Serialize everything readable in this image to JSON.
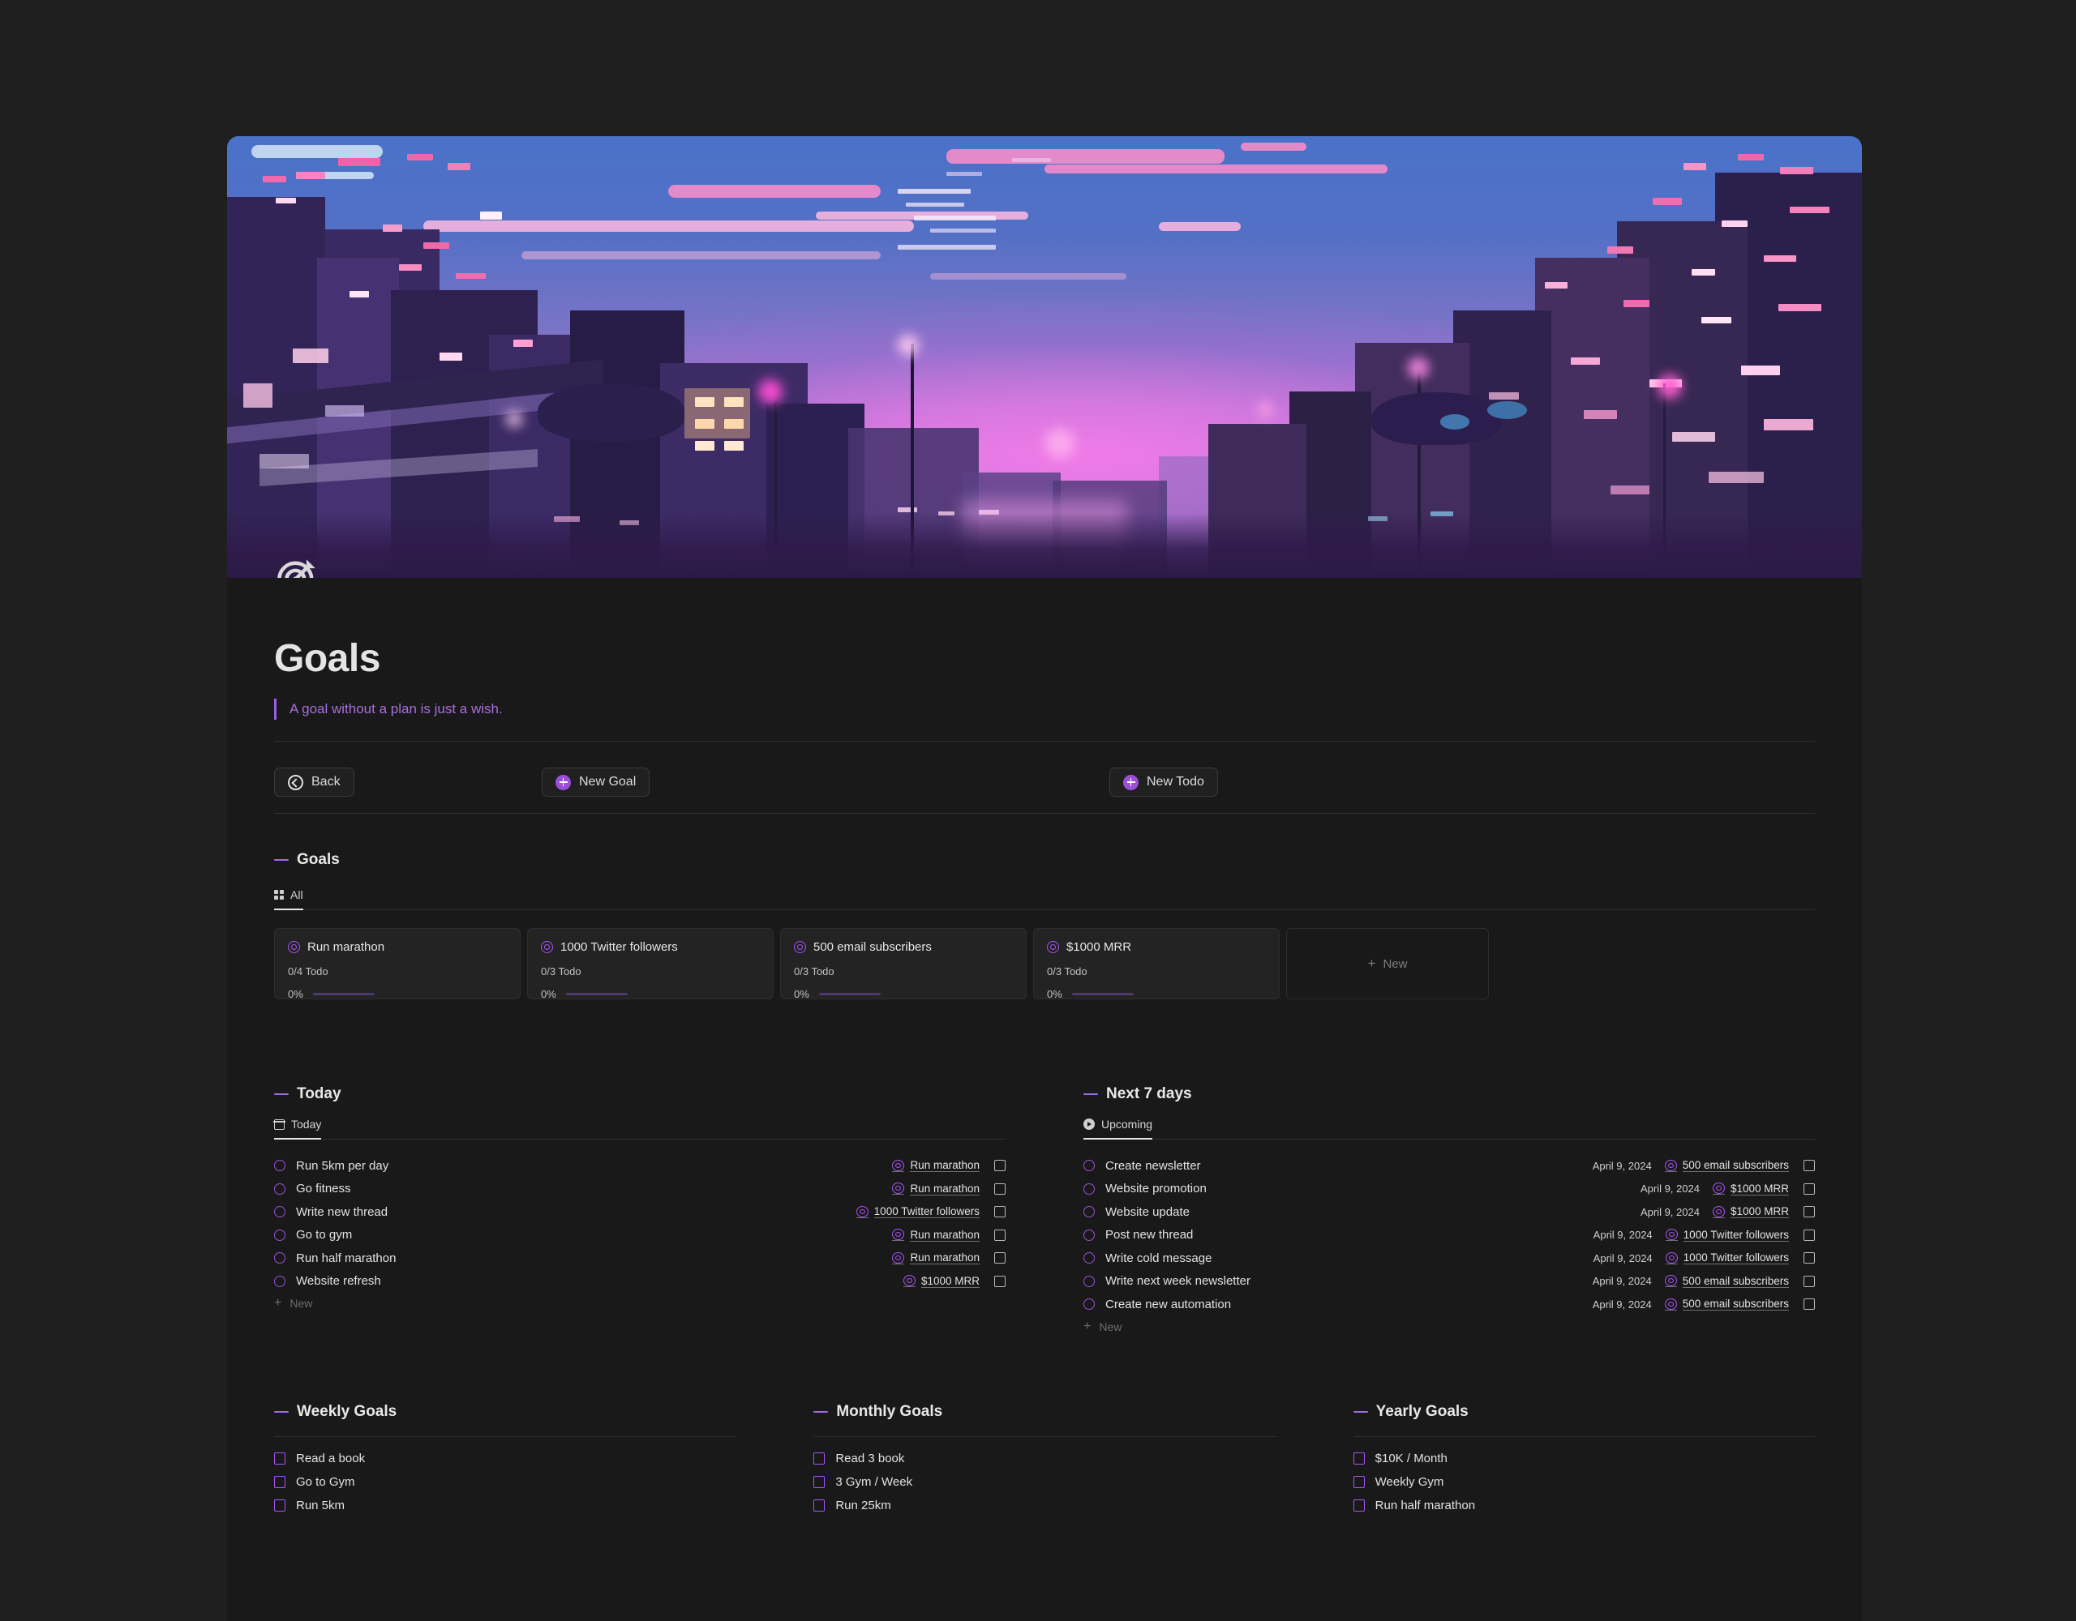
{
  "page": {
    "icon": "target-icon",
    "title": "Goals",
    "quote": "A goal without a plan is just a wish."
  },
  "toolbar": {
    "back_label": "Back",
    "new_goal_label": "New Goal",
    "new_todo_label": "New Todo"
  },
  "goals_section": {
    "heading": "Goals",
    "tab_label": "All",
    "new_card_label": "New",
    "cards": [
      {
        "title": "Run marathon",
        "todo": "0/4 Todo",
        "percent": "0%"
      },
      {
        "title": "1000 Twitter followers",
        "todo": "0/3 Todo",
        "percent": "0%"
      },
      {
        "title": "500 email subscribers",
        "todo": "0/3 Todo",
        "percent": "0%"
      },
      {
        "title": "$1000 MRR",
        "todo": "0/3 Todo",
        "percent": "0%"
      }
    ]
  },
  "today_section": {
    "heading": "Today",
    "tab_label": "Today",
    "new_label": "New",
    "tasks": [
      {
        "name": "Run 5km per day",
        "goal": "Run marathon"
      },
      {
        "name": "Go fitness",
        "goal": "Run marathon"
      },
      {
        "name": "Write new thread",
        "goal": "1000 Twitter followers"
      },
      {
        "name": "Go to gym",
        "goal": "Run marathon"
      },
      {
        "name": "Run half marathon",
        "goal": "Run marathon"
      },
      {
        "name": "Website refresh",
        "goal": "$1000 MRR"
      }
    ]
  },
  "next7_section": {
    "heading": "Next 7 days",
    "tab_label": "Upcoming",
    "new_label": "New",
    "tasks": [
      {
        "name": "Create newsletter",
        "date": "April 9, 2024",
        "goal": "500 email subscribers"
      },
      {
        "name": "Website promotion",
        "date": "April 9, 2024",
        "goal": "$1000 MRR"
      },
      {
        "name": "Website update",
        "date": "April 9, 2024",
        "goal": "$1000 MRR"
      },
      {
        "name": "Post new thread",
        "date": "April 9, 2024",
        "goal": "1000 Twitter followers"
      },
      {
        "name": "Write cold message",
        "date": "April 9, 2024",
        "goal": "1000 Twitter followers"
      },
      {
        "name": "Write next week newsletter",
        "date": "April 9, 2024",
        "goal": "500 email subscribers"
      },
      {
        "name": "Create new automation",
        "date": "April 9, 2024",
        "goal": "500 email subscribers"
      }
    ]
  },
  "weekly_goals": {
    "heading": "Weekly Goals",
    "items": [
      "Read a book",
      "Go to Gym",
      "Run 5km"
    ]
  },
  "monthly_goals": {
    "heading": "Monthly Goals",
    "items": [
      "Read 3 book",
      "3 Gym / Week",
      "Run 25km"
    ]
  },
  "yearly_goals": {
    "heading": "Yearly Goals",
    "items": [
      "$10K / Month",
      "Weekly Gym",
      "Run half marathon"
    ]
  },
  "colors": {
    "accent": "#a855f7",
    "accent_button": "#9b4fd8",
    "background": "#1f1f1f",
    "page_background": "#191919",
    "card_background": "#232323",
    "quote_text": "#a86ee0"
  }
}
